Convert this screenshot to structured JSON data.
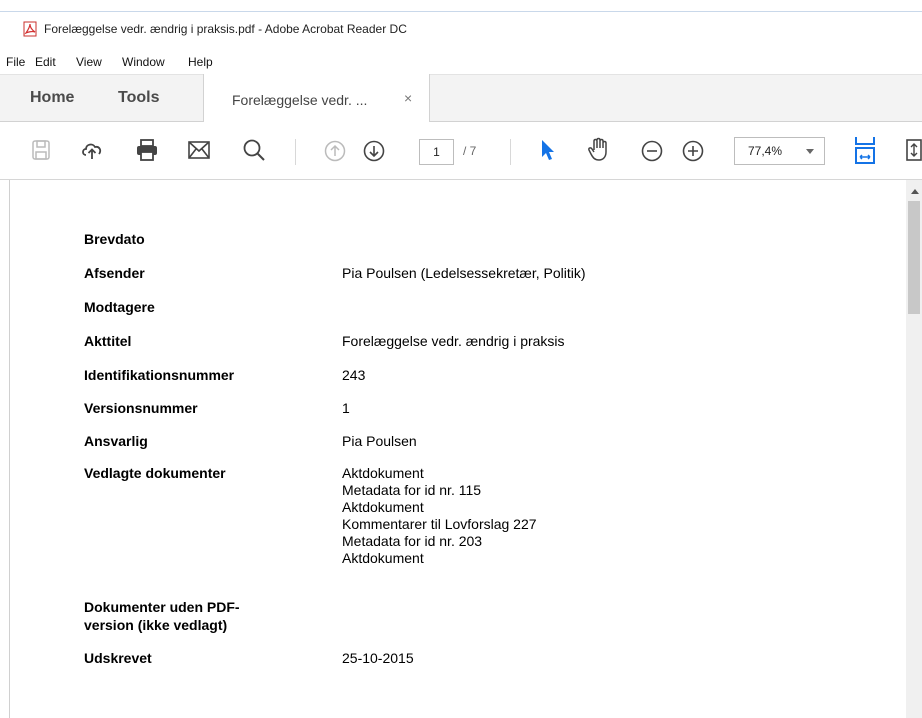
{
  "window": {
    "title": "Forelæggelse vedr. ændrig i praksis.pdf - Adobe Acrobat Reader DC"
  },
  "menu": [
    "File",
    "Edit",
    "View",
    "Window",
    "Help"
  ],
  "tabs": {
    "home": "Home",
    "tools": "Tools",
    "document": "Forelæggelse vedr. ...",
    "close": "×"
  },
  "toolbar": {
    "icons": [
      "save-icon",
      "upload-cloud-icon",
      "print-icon",
      "email-icon",
      "search-icon",
      "page-up-icon",
      "page-down-icon",
      "select-pointer-icon",
      "hand-tool-icon",
      "zoom-out-icon",
      "zoom-in-icon",
      "fit-page-icon",
      "fullscreen-icon"
    ],
    "page_current": "1",
    "page_total": "/ 7",
    "zoom": "77,4%"
  },
  "colors": {
    "accent": "#1473e6",
    "pdf_red": "#d32f2f"
  },
  "document": {
    "fields": [
      {
        "label": "Brevdato",
        "value": ""
      },
      {
        "label": "Afsender",
        "value": "Pia Poulsen (Ledelsessekretær, Politik)"
      },
      {
        "label": "Modtagere",
        "value": ""
      },
      {
        "label": "Akttitel",
        "value": "Forelæggelse vedr. ændrig i praksis"
      },
      {
        "label": "Identifikationsnummer",
        "value": "243"
      },
      {
        "label": "Versionsnummer",
        "value": "1"
      },
      {
        "label": "Ansvarlig",
        "value": "Pia Poulsen"
      },
      {
        "label": "Vedlagte dokumenter",
        "values": [
          "Aktdokument",
          "Metadata for id nr. 115",
          "Aktdokument",
          "Kommentarer til Lovforslag 227",
          "Metadata for id nr. 203",
          "Aktdokument"
        ]
      },
      {
        "label_lines": [
          "Dokumenter uden PDF-",
          "version (ikke vedlagt)"
        ],
        "value": ""
      },
      {
        "label": "Udskrevet",
        "value": "25-10-2015"
      }
    ]
  }
}
